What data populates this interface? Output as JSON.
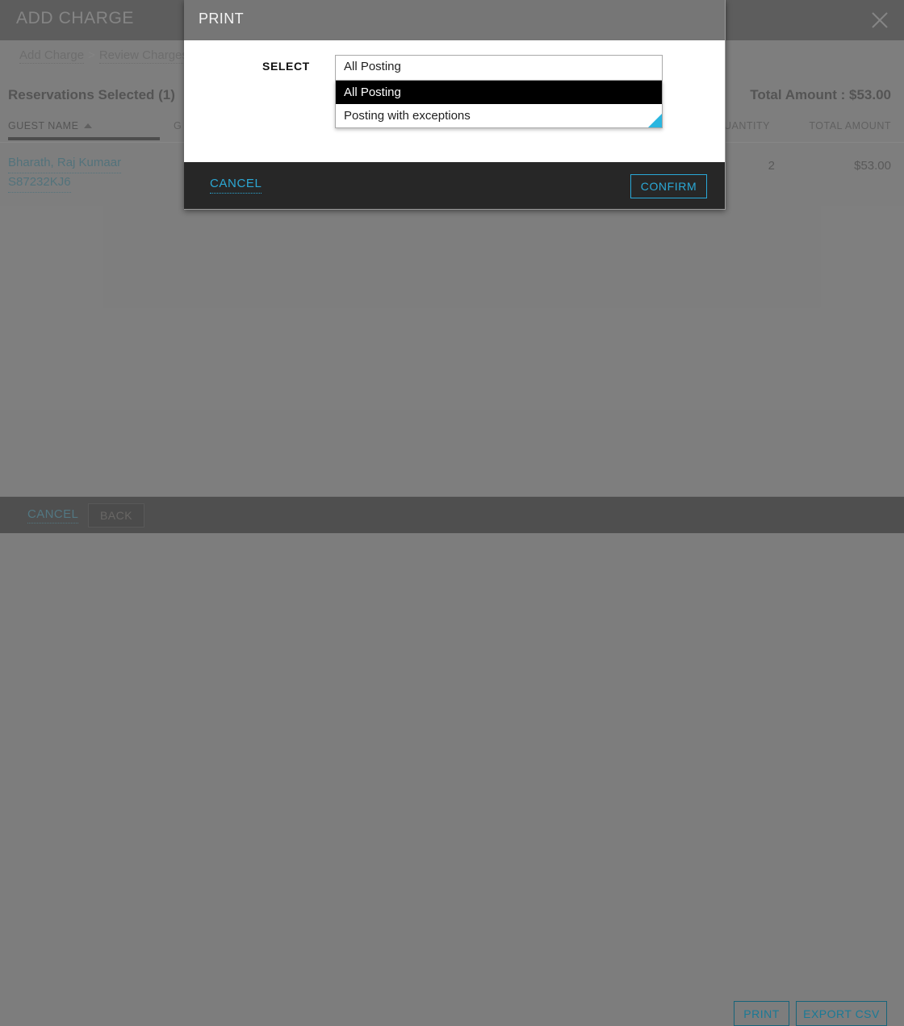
{
  "app": {
    "title": "ADD CHARGE",
    "close_icon": "close-icon",
    "breadcrumb": {
      "first": "Add Charge",
      "separator": ">",
      "second": "Review Charges"
    },
    "section_title": "Reservations Selected (1)",
    "total_amount": "Total Amount : $53.00"
  },
  "table": {
    "columns": [
      {
        "label": "GUEST NAME",
        "sorted": true,
        "sort_direction": "asc"
      },
      {
        "label": "G",
        "sorted": false
      },
      {
        "label": "UANTITY",
        "sorted": false
      },
      {
        "label": "TOTAL AMOUNT",
        "sorted": false
      }
    ],
    "rows": [
      {
        "guest_name": "Bharath, Raj Kumaar",
        "confirmation_number": "S87232KJ6",
        "quantity": "2",
        "total_amount": "$53.00"
      }
    ]
  },
  "bottom_bar": {
    "cancel_label": "CANCEL",
    "back_label": "BACK",
    "print_label": "PRINT",
    "export_csv_label": "EXPORT CSV"
  },
  "modal": {
    "title": "PRINT",
    "select_label": "SELECT",
    "select_value": "All Posting",
    "options": [
      {
        "label": "All Posting",
        "selected": true
      },
      {
        "label": "Posting with exceptions",
        "selected": false
      }
    ],
    "cancel_label": "CANCEL",
    "confirm_label": "CONFIRM",
    "resize_grip_icon": "resize-grip-icon"
  },
  "colors": {
    "accent_cyan": "#29a8d8",
    "link_teal": "#1c6376",
    "page_background": "#7d7d7d",
    "header_dark": "#333333",
    "modal_header_gray": "#767676",
    "modal_footer_dark": "#272727",
    "grip_cyan": "#29b6e0"
  }
}
